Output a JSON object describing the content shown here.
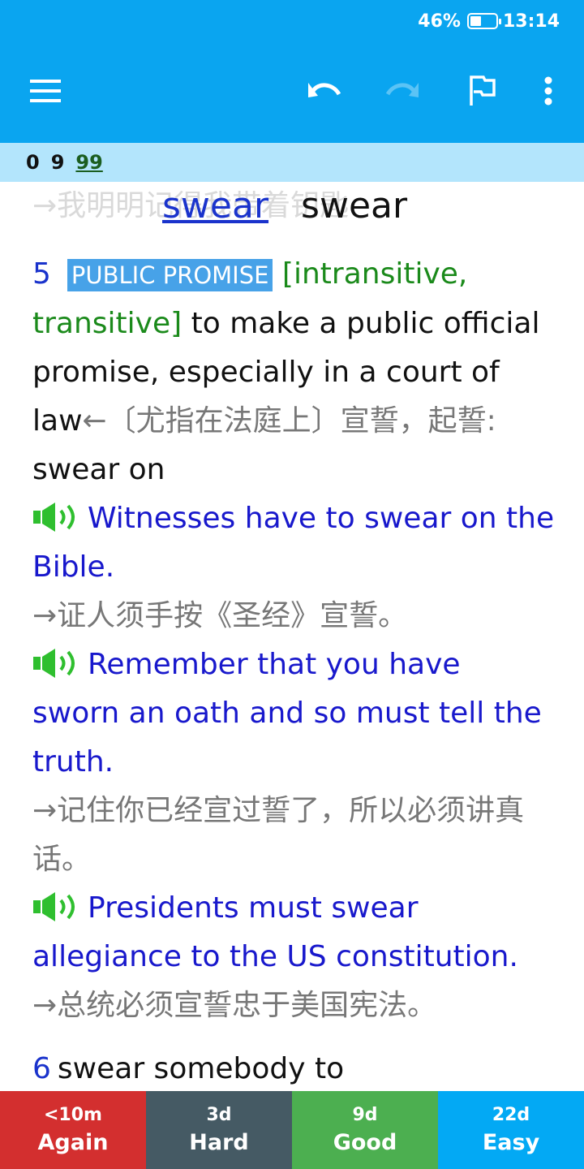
{
  "status_bar": {
    "battery": "46%",
    "battery_level": 0.46,
    "time": "13:14"
  },
  "toolbar": {
    "icons": [
      "menu-icon",
      "undo-icon",
      "redo-icon",
      "flag-icon",
      "more-vert-icon"
    ],
    "colors": {
      "appbar": "#0aa5f0",
      "counts_bar": "#b3e5fc"
    }
  },
  "counts": {
    "new": "0",
    "learning": "9",
    "review": "99"
  },
  "card": {
    "ghost_text": "→我明明记得我带着钥匙",
    "headword_link": "swear",
    "headword": "swear",
    "sense": {
      "number": "5",
      "signpost": "PUBLIC PROMISE",
      "grammar": "[intransitive, transitive]",
      "definition": "to make a public official promise, especially in a court of law",
      "translation": "←〔尤指在法庭上〕宣誓，起誓:",
      "collocation": "swear on",
      "examples": [
        {
          "text": "Witnesses have to swear on the Bible.",
          "translation": "→证人须手按《圣经》宣誓。"
        },
        {
          "text": "Remember that you have sworn an oath and so must tell the truth.",
          "translation": "→记住你已经宣过誓了，所以必须讲真话。"
        },
        {
          "text": "Presidents must swear allegiance to the US constitution.",
          "translation": "→总统必须宣誓忠于美国宪法。"
        }
      ]
    },
    "next_sense": {
      "number": "6",
      "text": "swear somebody to"
    }
  },
  "answers": [
    {
      "interval": "<10m",
      "label": "Again",
      "color": "#d32f2f"
    },
    {
      "interval": "3d",
      "label": "Hard",
      "color": "#455a64"
    },
    {
      "interval": "9d",
      "label": "Good",
      "color": "#4caf50"
    },
    {
      "interval": "22d",
      "label": "Easy",
      "color": "#03a9f4"
    }
  ]
}
